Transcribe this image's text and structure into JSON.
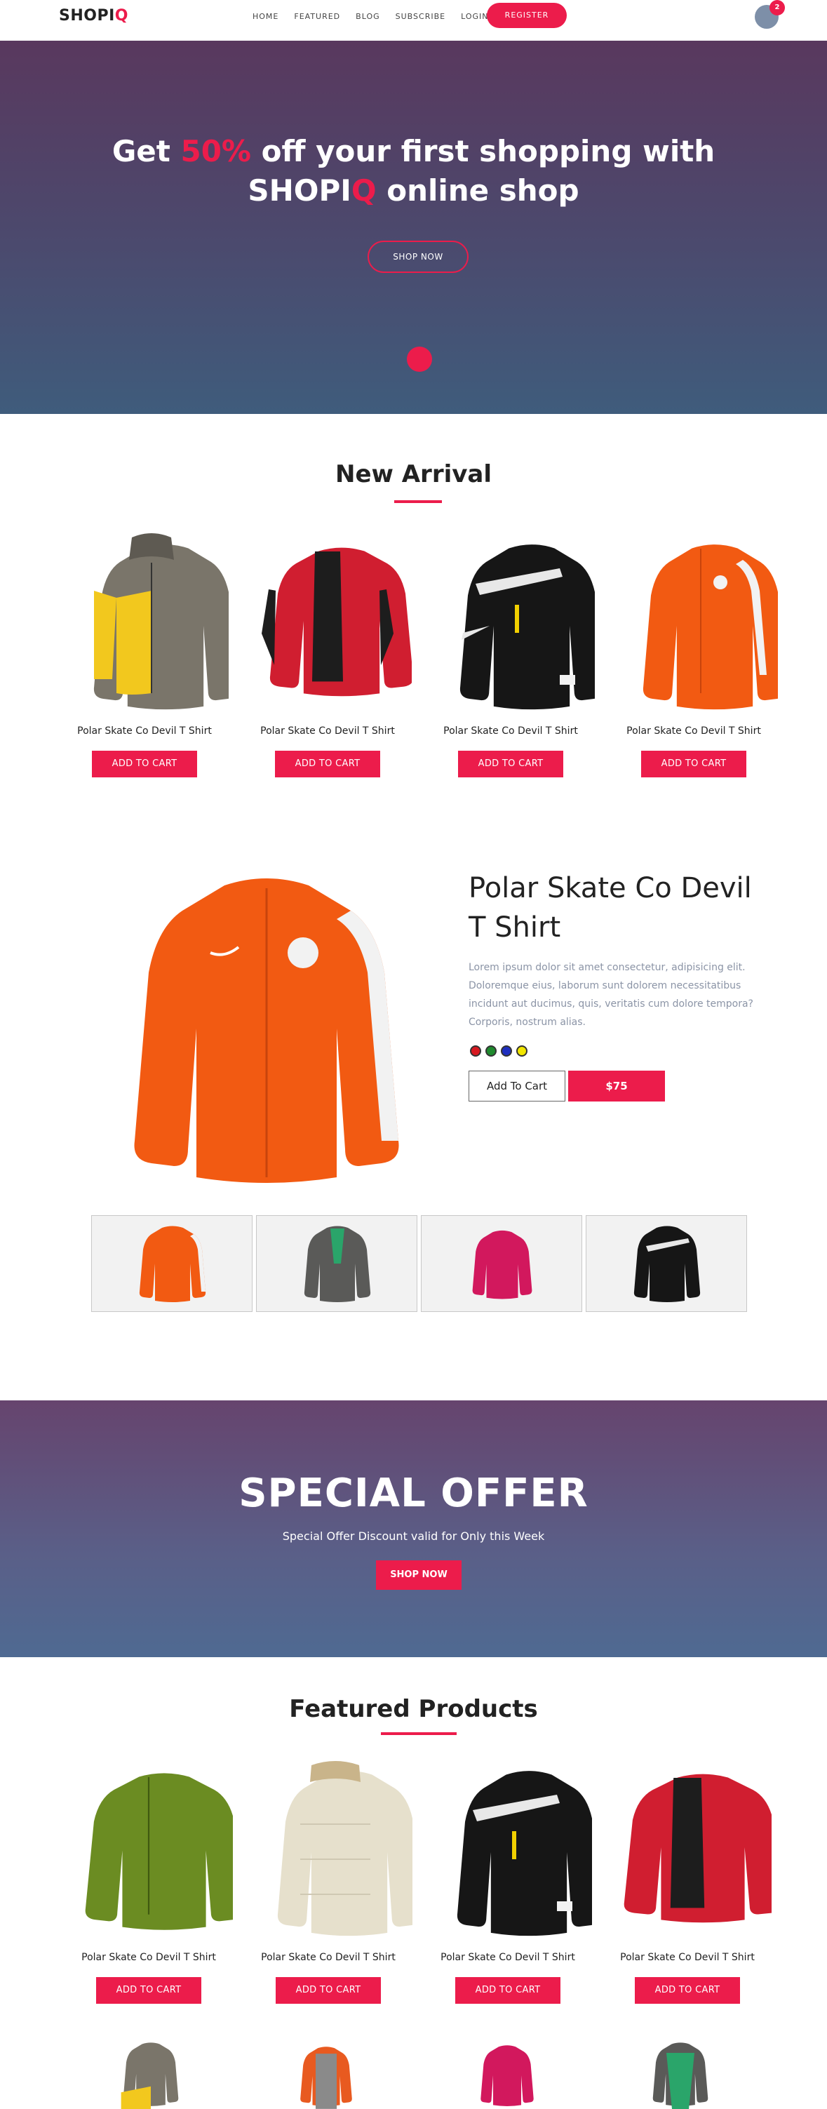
{
  "nav": {
    "logo_main": "SHOPI",
    "logo_accent": "Q",
    "links": [
      "HOME",
      "FEATURED",
      "BLOG",
      "SUBSCRIBE",
      "LOGIN"
    ],
    "register_label": "REGISTER",
    "cart_count": "2"
  },
  "hero": {
    "line1_pre": "Get ",
    "line1_accent": "50%",
    "line1_post": " off your first shopping with",
    "line2_pre": "SHOPI",
    "line2_accent": "Q",
    "line2_post": " online shop",
    "button_label": "SHOP NOW"
  },
  "new_arrival": {
    "title": "New Arrival",
    "products": [
      {
        "name": "Polar Skate Co Devil T Shirt",
        "button": "ADD TO CART",
        "image": "grey-yellow-puffer-jacket"
      },
      {
        "name": "Polar Skate Co Devil T Shirt",
        "button": "ADD TO CART",
        "image": "red-black-jacket"
      },
      {
        "name": "Polar Skate Co Devil T Shirt",
        "button": "ADD TO CART",
        "image": "black-white-track-jacket"
      },
      {
        "name": "Polar Skate Co Devil T Shirt",
        "button": "ADD TO CART",
        "image": "orange-track-jacket"
      }
    ]
  },
  "detail": {
    "title": "Polar Skate Co Devil T Shirt",
    "description": "Lorem ipsum dolor sit amet consectetur, adipisicing elit. Doloremque eius, laborum sunt dolorem necessitatibus incidunt aut ducimus, quis, veritatis cum dolore tempora? Corporis, nostrum alias.",
    "swatches": [
      "#d71920",
      "#1f8a2e",
      "#1f2fbf",
      "#f2e600"
    ],
    "add_label": "Add To Cart",
    "price": "$75",
    "thumbnails": [
      "orange-track-jacket",
      "grey-green-jacket",
      "pink-fleece-jacket",
      "black-white-track-jacket"
    ]
  },
  "offer": {
    "title": "SPECIAL OFFER",
    "subtitle": "Special Offer Discount valid for Only this Week",
    "button_label": "SHOP NOW"
  },
  "featured": {
    "title": "Featured Products",
    "products": [
      {
        "name": "Polar Skate Co Devil T Shirt",
        "button": "ADD TO CART",
        "image": "olive-green-jacket"
      },
      {
        "name": "Polar Skate Co Devil T Shirt",
        "button": "ADD TO CART",
        "image": "cream-puffer-jacket"
      },
      {
        "name": "Polar Skate Co Devil T Shirt",
        "button": "ADD TO CART",
        "image": "black-white-track-jacket"
      },
      {
        "name": "Polar Skate Co Devil T Shirt",
        "button": "ADD TO CART",
        "image": "red-black-jacket"
      }
    ],
    "second_row_images": [
      "grey-yellow-puffer-jacket",
      "orange-grey-jacket",
      "pink-fleece-jacket",
      "grey-green-jacket"
    ]
  },
  "colors": {
    "accent": "#ec1c4b",
    "hero_top": "#59385e",
    "hero_bottom": "#3f5c7c"
  }
}
